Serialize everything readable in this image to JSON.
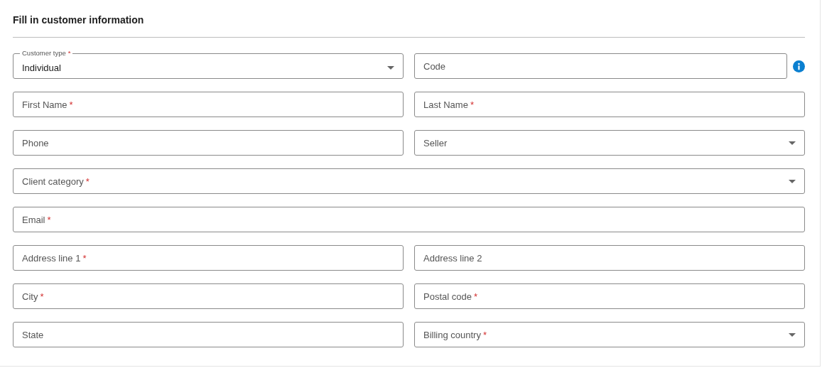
{
  "title": "Fill in customer information",
  "rows": [
    [
      {
        "kind": "select",
        "label": "Customer type",
        "required_mark": "*",
        "value": "Individual",
        "info": false
      },
      {
        "kind": "text",
        "label": "Code",
        "info": true
      }
    ],
    [
      {
        "kind": "text",
        "label": "First Name",
        "required_mark": "*",
        "info": false
      },
      {
        "kind": "text",
        "label": "Last Name",
        "required_mark": "*",
        "info": false
      }
    ],
    [
      {
        "kind": "text",
        "label": "Phone",
        "info": false
      },
      {
        "kind": "select",
        "label": "Seller",
        "info": false
      }
    ],
    [
      {
        "kind": "select",
        "label": "Client category",
        "required_mark": "*",
        "info": false
      }
    ],
    [
      {
        "kind": "text",
        "label": "Email",
        "required_mark": "*",
        "info": false
      }
    ],
    [
      {
        "kind": "text",
        "label": "Address line 1",
        "required_mark": "*",
        "info": false
      },
      {
        "kind": "text",
        "label": "Address line 2",
        "info": false
      }
    ],
    [
      {
        "kind": "text",
        "label": "City",
        "required_mark": "*",
        "info": false
      },
      {
        "kind": "text",
        "label": "Postal code",
        "required_mark": "*",
        "info": false
      }
    ],
    [
      {
        "kind": "text",
        "label": "State",
        "info": false
      },
      {
        "kind": "select",
        "label": "Billing country",
        "required_mark": "*",
        "info": false
      }
    ]
  ]
}
